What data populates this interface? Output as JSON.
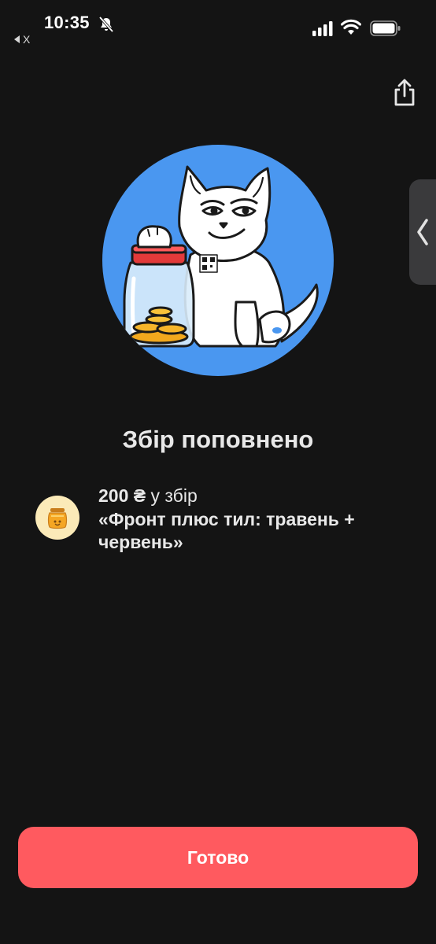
{
  "status_bar": {
    "time": "10:35",
    "back_app_label": "X",
    "icons": [
      "bell-slash-icon",
      "signal-icon",
      "wifi-icon",
      "battery-icon"
    ]
  },
  "header": {
    "share_icon": "share-icon"
  },
  "side_handle": {
    "icon": "chevron-left-icon"
  },
  "hero": {
    "illustration": "cat-with-coin-jar",
    "circle_color": "#4a97f0"
  },
  "content": {
    "title": "Збір поповнено",
    "amount": "200 ₴",
    "amount_suffix": " у збір",
    "jar_name": "«Фронт плюс тил: травень + червень»",
    "jar_icon": "honey-jar-icon"
  },
  "footer": {
    "done_label": "Готово",
    "button_color": "#ff5a5f"
  }
}
